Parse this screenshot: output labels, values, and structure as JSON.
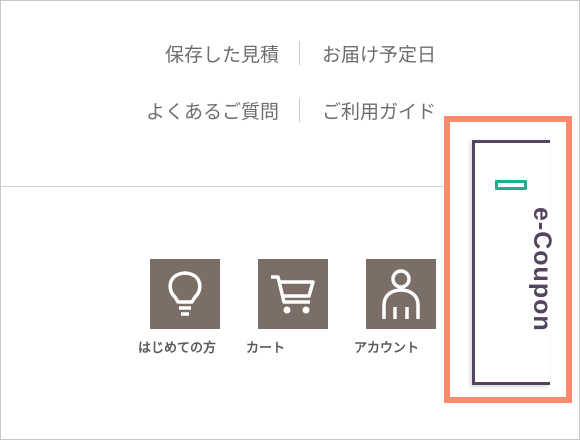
{
  "header": {
    "links_row1": [
      "保存した見積",
      "お届け予定日"
    ],
    "links_row2": [
      "よくあるご質問",
      "ご利用ガイド"
    ]
  },
  "nav_icons": [
    {
      "label": "はじめての方",
      "icon": "lightbulb-icon"
    },
    {
      "label": "カート",
      "icon": "cart-icon"
    },
    {
      "label": "アカウント",
      "icon": "person-icon"
    }
  ],
  "coupon": {
    "label": "e-Coupon"
  },
  "colors": {
    "icon_bg": "#7a6e67",
    "coupon_border": "#55435f",
    "coupon_accent": "#1cae92",
    "highlight": "#ff8b6e",
    "link_text": "#6e6e6e"
  }
}
